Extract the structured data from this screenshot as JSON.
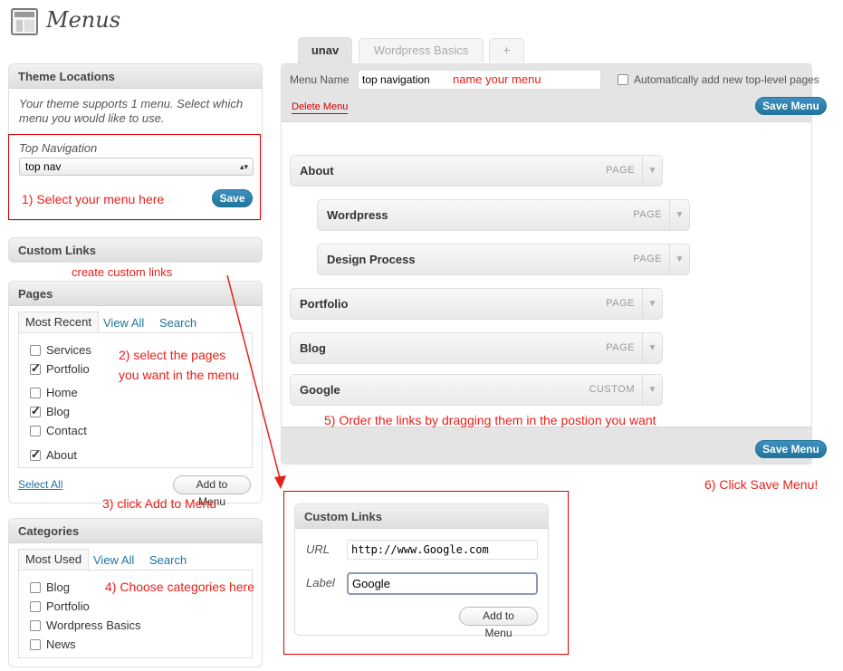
{
  "page": {
    "title": "Menus"
  },
  "theme_locations": {
    "heading": "Theme Locations",
    "description": "Your theme supports 1 menu. Select which menu you would like to use.",
    "location_label": "Top Navigation",
    "selected_menu": "top nav",
    "save_label": "Save"
  },
  "custom_links_sidebar": {
    "heading": "Custom Links"
  },
  "pages": {
    "heading": "Pages",
    "tabs": [
      "Most Recent",
      "View All",
      "Search"
    ],
    "items": [
      {
        "label": "Services",
        "checked": false
      },
      {
        "label": "Portfolio",
        "checked": true
      },
      {
        "label": "Home",
        "checked": false
      },
      {
        "label": "Blog",
        "checked": true
      },
      {
        "label": "Contact",
        "checked": false
      },
      {
        "label": "About",
        "checked": true
      }
    ],
    "select_all": "Select All",
    "add_label": "Add to Menu"
  },
  "categories": {
    "heading": "Categories",
    "tabs": [
      "Most Used",
      "View All",
      "Search"
    ],
    "items": [
      {
        "label": "Blog",
        "checked": false
      },
      {
        "label": "Portfolio",
        "checked": false
      },
      {
        "label": "Wordpress Basics",
        "checked": false
      },
      {
        "label": "News",
        "checked": false
      }
    ]
  },
  "menu_tabs": [
    "unav",
    "Wordpress Basics",
    "+"
  ],
  "editor": {
    "name_label": "Menu Name",
    "name_value": "top navigation",
    "auto_add_label": "Automatically add new top-level pages",
    "delete_label": "Delete Menu",
    "save_label": "Save Menu"
  },
  "menu_items": [
    {
      "title": "About",
      "type": "PAGE",
      "depth": 0
    },
    {
      "title": "Wordpress",
      "type": "PAGE",
      "depth": 1
    },
    {
      "title": "Design Process",
      "type": "PAGE",
      "depth": 1
    },
    {
      "title": "Portfolio",
      "type": "PAGE",
      "depth": 0
    },
    {
      "title": "Blog",
      "type": "PAGE",
      "depth": 0
    },
    {
      "title": "Google",
      "type": "CUSTOM",
      "depth": 0
    }
  ],
  "custom_links_panel": {
    "heading": "Custom Links",
    "url_label": "URL",
    "url_value": "http://www.Google.com",
    "label_label": "Label",
    "label_value": "Google",
    "add_label": "Add to Menu"
  },
  "annotations": {
    "name_menu": "name your menu",
    "step1": "1) Select your menu here",
    "create_custom": "create custom links",
    "step2_line1": "2) select the pages",
    "step2_line2": "you want in the menu",
    "step3": "3) click Add to Menu",
    "step4": "4) Choose categories here",
    "step5": "5) Order the links by dragging them in the postion you want",
    "step6": "6) Click Save Menu!"
  },
  "colors": {
    "annotation": "#e8201a",
    "button": "#21759b",
    "link": "#21759b"
  }
}
